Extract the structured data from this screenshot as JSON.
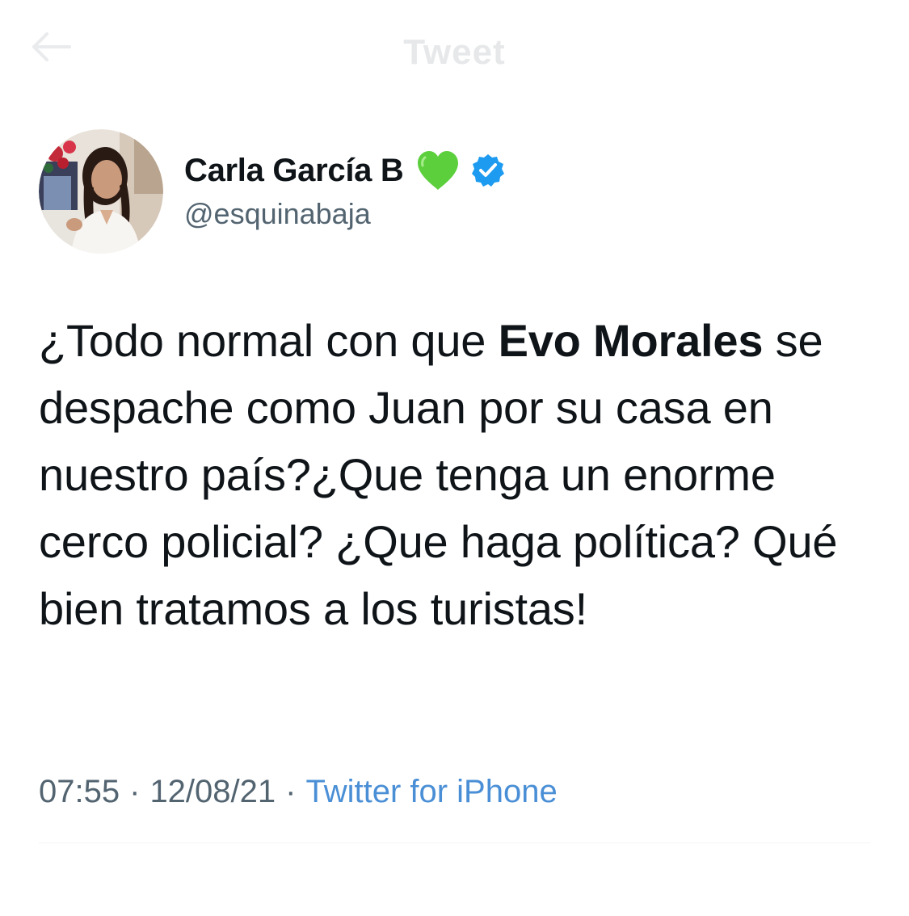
{
  "topbar": {
    "back_icon": "arrow-left-icon",
    "title": "Tweet"
  },
  "author": {
    "avatar_icon": "profile-photo",
    "display_name": "Carla García B",
    "emoji": "green-heart",
    "verified_icon": "verified-badge-icon",
    "handle": "@esquinabaja"
  },
  "tweet": {
    "text_before": "¿Todo normal con que ",
    "text_bold": "Evo Morales",
    "text_after": " se despache como Juan por su casa en nuestro país?¿Que tenga un enorme cerco policial? ¿Que haga política? Qué bien tratamos a los turistas!",
    "time": "07:55",
    "separator": "·",
    "date": "12/08/21",
    "source": "Twitter for iPhone"
  },
  "colors": {
    "text": "#0f1419",
    "secondary": "#536471",
    "link": "#4a8fd6",
    "verified": "#1d9bf0",
    "heart": "#5ccf3c"
  }
}
